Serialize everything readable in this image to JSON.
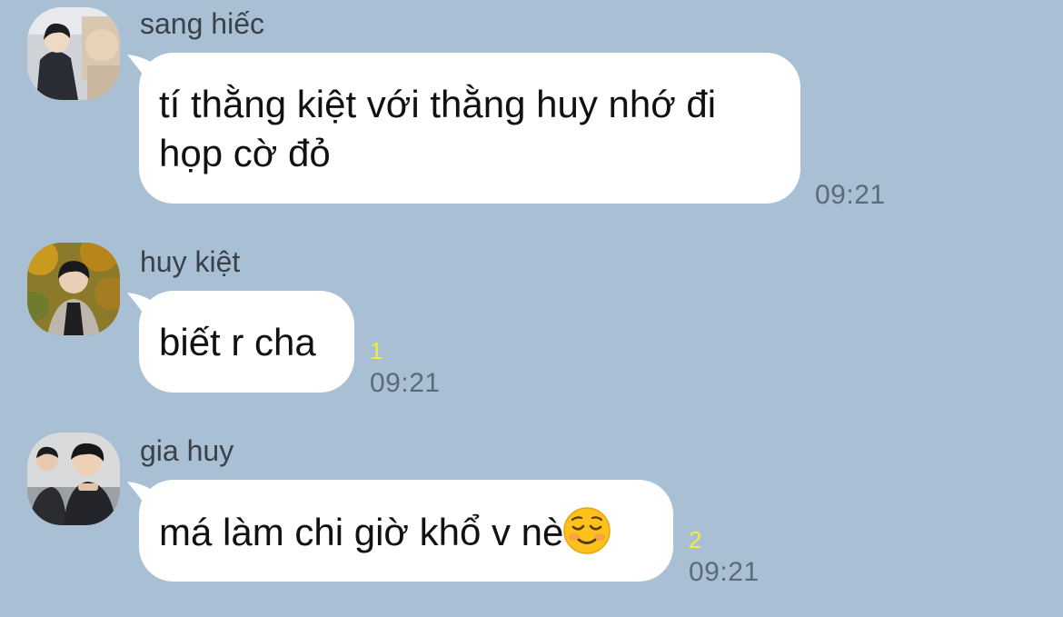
{
  "messages": [
    {
      "sender": "sang hiếc",
      "text": "tí thằng kiệt với thằng huy nhớ đi\nhọp cờ đỏ",
      "time": "09:21",
      "unread": ""
    },
    {
      "sender": "huy kiệt",
      "text": "biết r cha",
      "time": "09:21",
      "unread": "1"
    },
    {
      "sender": "gia huy",
      "text": "má làm chi giờ khổ v nè",
      "emoji": "relieved-smiling-face-emoji",
      "time": "09:21",
      "unread": "2"
    }
  ],
  "colors": {
    "background": "#a9bfd3",
    "bubble": "#ffffff",
    "unread": "#f4ec3d",
    "time": "#5d6a77"
  }
}
